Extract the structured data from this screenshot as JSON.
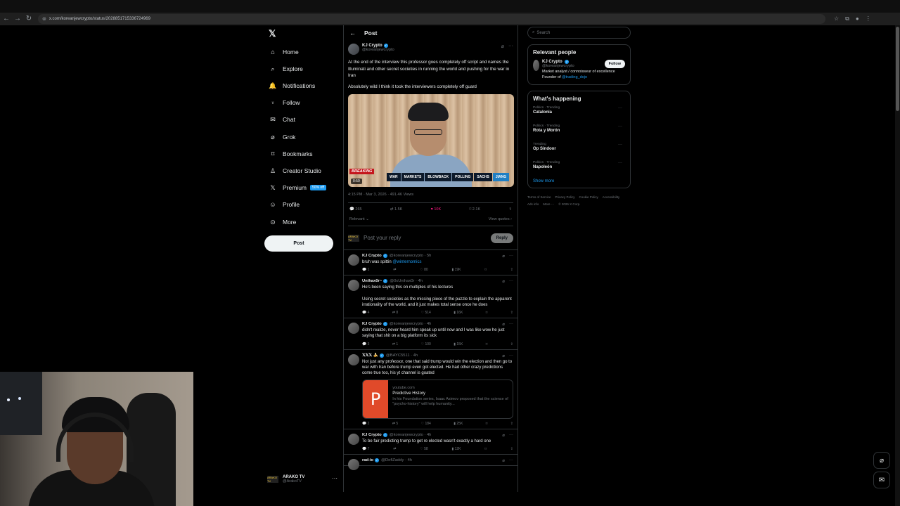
{
  "browser": {
    "url": "x.com/koreanjewcrypto/status/2028851715336724969"
  },
  "nav": {
    "items": [
      {
        "label": "Home",
        "icon": "home-icon"
      },
      {
        "label": "Explore",
        "icon": "search-icon"
      },
      {
        "label": "Notifications",
        "icon": "bell-icon"
      },
      {
        "label": "Follow",
        "icon": "person-plus-icon"
      },
      {
        "label": "Chat",
        "icon": "mail-icon"
      },
      {
        "label": "Grok",
        "icon": "grok-icon"
      },
      {
        "label": "Bookmarks",
        "icon": "bookmark-icon"
      },
      {
        "label": "Creator Studio",
        "icon": "creator-icon"
      },
      {
        "label": "Premium",
        "icon": "x-icon",
        "badge": "50% off"
      },
      {
        "label": "Profile",
        "icon": "profile-icon"
      },
      {
        "label": "More",
        "icon": "more-circle-icon"
      }
    ],
    "post_button": "Post",
    "account": {
      "name": "ARAKO TV",
      "handle": "@ArakoTV",
      "avatar_text": "ARAKO TV"
    }
  },
  "header": {
    "title": "Post"
  },
  "tweet": {
    "author": "KJ Crypto",
    "handle": "@koreanjewcrypto",
    "paragraph1": "At the end of the interview this professor goes completely off script and names the Illuminati and other secret societies in running the world and pushing for the war in Iran",
    "paragraph2": "Absolutely wild I think it took the interviewers completely off guard",
    "video": {
      "breaking": "BREAKING",
      "timecode": "0:59",
      "chips": [
        "WAR",
        "MARKETS",
        "BLOWBACK",
        "POLLING",
        "SACHS",
        "JIANG"
      ]
    },
    "meta": "4:15 PM · Mar 3, 2026 · 491.4K Views",
    "stats": {
      "replies": "265",
      "reposts": "1.5K",
      "likes": "10K",
      "bookmarks": "2.1K"
    },
    "relevant": "Relevant",
    "view_quotes": "View quotes"
  },
  "compose": {
    "placeholder": "Post your reply",
    "reply_button": "Reply",
    "avatar_text": "ARAKO TV"
  },
  "replies": [
    {
      "name": "KJ Crypto",
      "handle": "@koreanjewcrypto · 5h",
      "text": "bruh was spittin",
      "link": "@winternomics",
      "stats": [
        "1",
        "",
        "80",
        "19K"
      ]
    },
    {
      "name": "Unihax0r~",
      "handle": "@0xUnihax0r · 4h",
      "text": "He's been saying this on multiples of his lectures",
      "text2": "Using secret societies as the missing piece of the puzzle to explain the apparent irrationality of the world, and it just makes total sense once he does",
      "stats": [
        "4",
        "8",
        "514",
        "16K"
      ]
    },
    {
      "name": "KJ Crypto",
      "handle": "@koreanjewcrypto · 4h",
      "text": "didn't realize, never heard him speak up until now and I was like wow he just saying that shit on a big platform its sick",
      "stats": [
        "3",
        "1",
        "100",
        "15K"
      ]
    },
    {
      "name": "𝕏𝕏𝕏 🍌",
      "handle": "@BAYC5511 · 4h",
      "text": "Not just any professor, one that said trump would win the election and then go to war with Iran before trump even got elected. He had other crazy predictions come true too, his yt channel is goated",
      "card": {
        "letter": "P",
        "domain": "youtube.com",
        "title": "Predictive History",
        "desc": "In his Foundation series, Isaac Asimov proposed that the science of \"psycho-history\" will help humanity..."
      },
      "stats": [
        "2",
        "5",
        "184",
        "25K"
      ]
    },
    {
      "name": "KJ Crypto",
      "handle": "@koreanjewcrypto · 4h",
      "text": "To be fair predicting trump to get re elected wasn't exactly a hard one",
      "stats": [
        "7",
        "",
        "58",
        "12K"
      ]
    },
    {
      "name": "rad-io",
      "handle": "@DefiZaddy · 4h"
    }
  ],
  "sidebar": {
    "search_placeholder": "Search",
    "relevant_title": "Relevant people",
    "relevant_user": {
      "name": "KJ Crypto",
      "handle": "@koreanjewcrypto",
      "bio": "Market analyst / connoisseur of excellence Founder of",
      "bio_link": "@trading_dojo",
      "follow": "Follow"
    },
    "trending_title": "What's happening",
    "trends": [
      {
        "context": "Politics · Trending",
        "title": "Catalonia"
      },
      {
        "context": "Politics · Trending",
        "title": "Rota y Morón"
      },
      {
        "context": "Trending",
        "title": "Op Sindoor"
      },
      {
        "context": "Politics · Trending",
        "title": "Napoleón"
      }
    ],
    "show_more": "Show more",
    "footer": [
      "Terms of Service",
      "Privacy Policy",
      "Cookie Policy",
      "Accessibility",
      "Ads info",
      "More ···",
      "© 2026 X Corp."
    ]
  },
  "colors": {
    "accent": "#1d9bf0",
    "like": "#f91880",
    "border": "#2f3336"
  }
}
